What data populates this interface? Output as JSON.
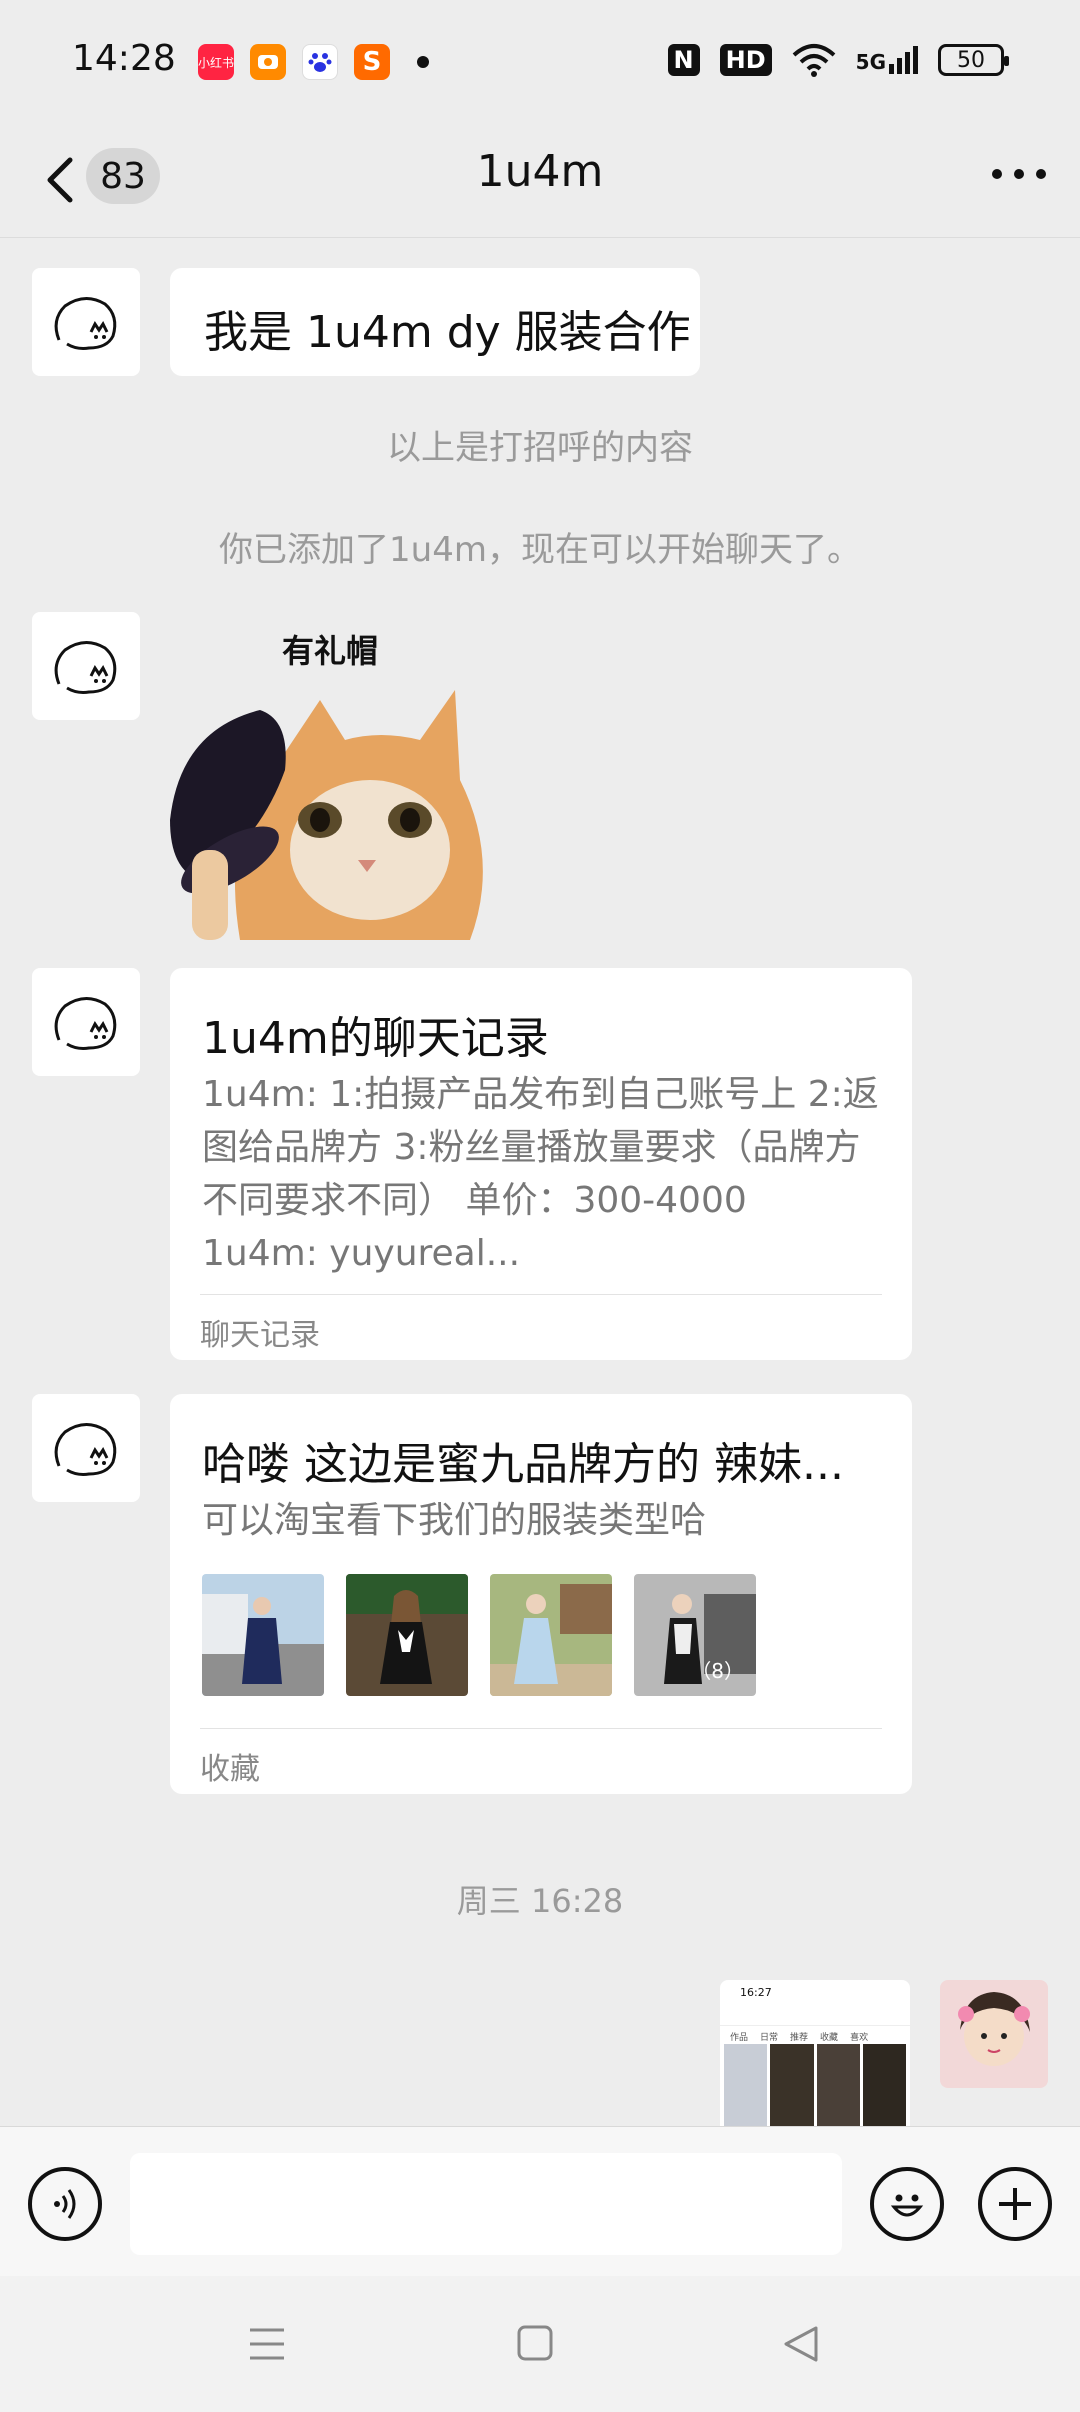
{
  "status_bar": {
    "time": "14:28",
    "apps": [
      {
        "icon": "xiaohongshu-icon",
        "label": "小红书",
        "color": "#ff2442"
      },
      {
        "icon": "orange-app-icon",
        "label": "",
        "color": "#ff8a00"
      },
      {
        "icon": "baidu-icon",
        "label": "",
        "color": "#2932e1"
      },
      {
        "icon": "s-app-icon",
        "label": "S",
        "color": "#ff6a00"
      }
    ],
    "nfc": "N",
    "hd": "HD",
    "network": "5G",
    "battery": "50"
  },
  "header": {
    "unread_count": "83",
    "title": "1u4m"
  },
  "messages": {
    "greeting_text": "我是 1u4m dy 服装合作",
    "system_1": "以上是打招呼的内容",
    "system_2": "你已添加了1u4m，现在可以开始聊天了。",
    "sticker_caption": "有礼帽",
    "chat_record": {
      "title": "1u4m的聊天记录",
      "lines": [
        "1u4m: 1:拍摄产品发布到自己账号上 2:返",
        "图给品牌方 3:粉丝量播放量要求（品牌方",
        "不同要求不同） 单价：300-4000",
        "1u4m: yuyureal..."
      ],
      "footer": "聊天记录"
    },
    "favorite": {
      "title": "哈喽 这边是蜜九品牌方的 辣妹...",
      "subtitle": "可以淘宝看下我们的服装类型哈",
      "image_count": "（8）",
      "footer": "收藏"
    },
    "timestamp": "周三 16:28",
    "screenshot_preview": {
      "time": "16:27",
      "tabs": [
        "作品",
        "日常",
        "推荐",
        "收藏",
        "喜欢"
      ]
    }
  },
  "colors": {
    "background": "#ededed",
    "bubble": "#ffffff",
    "system_text": "#9a9a9a"
  }
}
